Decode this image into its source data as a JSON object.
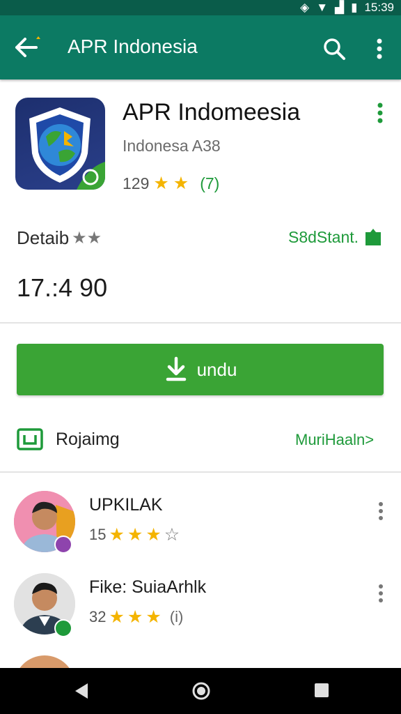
{
  "status_bar": {
    "time": "15:39"
  },
  "app_bar": {
    "title": "APR Indonesia"
  },
  "app": {
    "name": "APR Indomeesia",
    "developer": "Indonesa A38",
    "rating_count": "129",
    "rating_tail": "(7)"
  },
  "details": {
    "label": "Detaib",
    "link": "S8dStant.",
    "number": "17.:4 90"
  },
  "install": {
    "label": "undu"
  },
  "row": {
    "label": "Rojaimg",
    "link": "MuriHaaln>"
  },
  "reviews": [
    {
      "name": "UPKILAK",
      "count": "15",
      "tail": ""
    },
    {
      "name": "Fike: SuiaArhlk",
      "count": "32",
      "tail": "(i)"
    }
  ],
  "colors": {
    "app_bar": "#0c7a63",
    "accent_green": "#3aa435",
    "star": "#f4b400"
  }
}
